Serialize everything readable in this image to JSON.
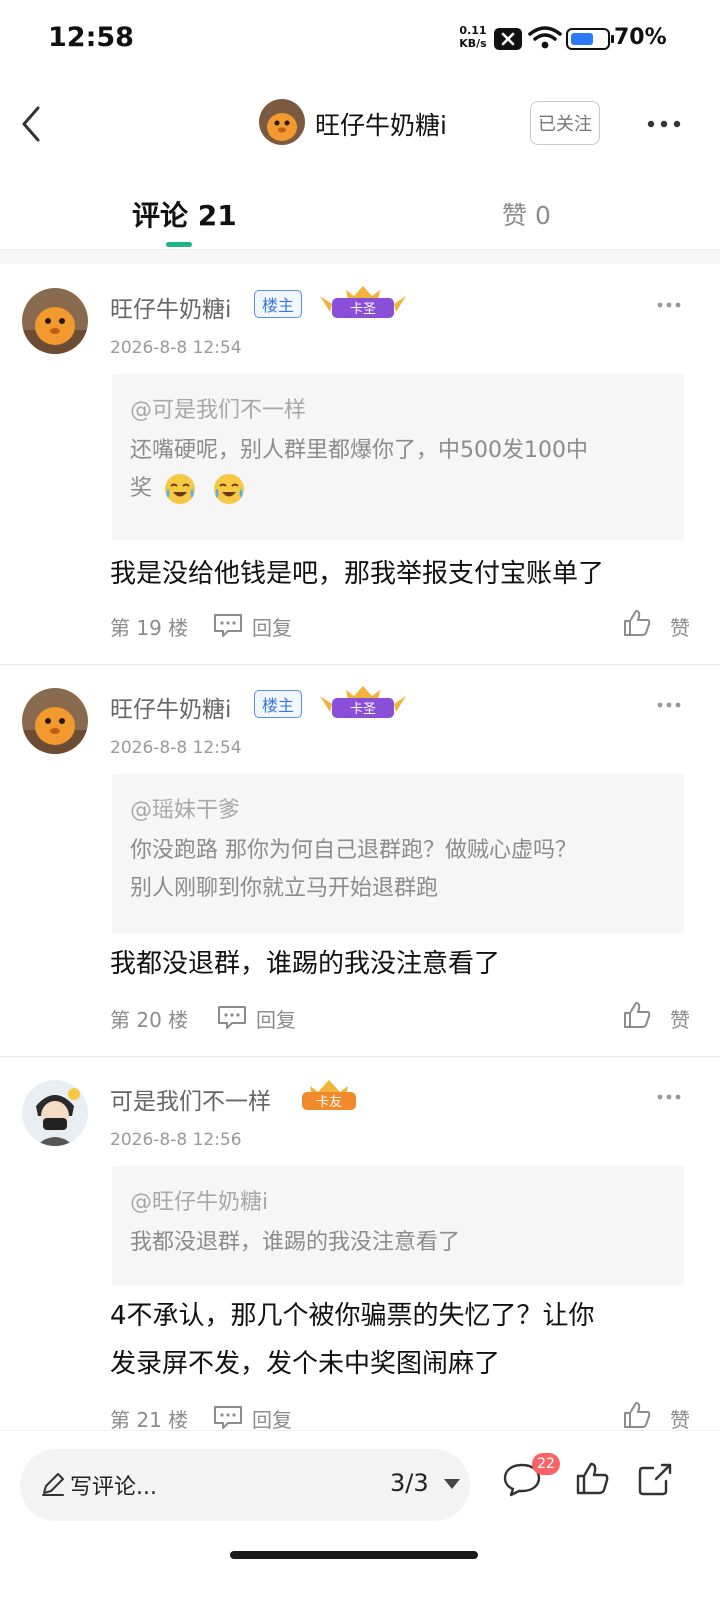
{
  "status_bar": {
    "time": "12:58",
    "net_speed": "0.11",
    "net_unit": "KB/s",
    "battery": "70%",
    "battery_level": 0.7
  },
  "header": {
    "username": "旺仔牛奶糖i",
    "follow_label": "已关注"
  },
  "tabs": {
    "comments_label": "评论 21",
    "likes_label": "赞 0"
  },
  "comments": [
    {
      "author": "旺仔牛奶糖i",
      "host_badge": "楼主",
      "level_badge": "卡圣",
      "time": "2026-8-8 12:54",
      "quote_target": "@可是我们不一样",
      "quote_text_1": "还嘴硬呢，别人群里都爆你了，中500发100中",
      "quote_text_2": "奖",
      "body": "我是没给他钱是吧，那我举报支付宝账单了",
      "floor": "第 19 楼",
      "reply_label": "回复",
      "like_label": "赞"
    },
    {
      "author": "旺仔牛奶糖i",
      "host_badge": "楼主",
      "level_badge": "卡圣",
      "time": "2026-8-8 12:54",
      "quote_target": "@瑶妹干爹",
      "quote_text_1": "你没跑路 那你为何自己退群跑？做贼心虚吗？",
      "quote_text_2": "别人刚聊到你就立马开始退群跑",
      "body": "我都没退群，谁踢的我没注意看了",
      "floor": "第 20 楼",
      "reply_label": "回复",
      "like_label": "赞"
    },
    {
      "author": "可是我们不一样",
      "level_badge": "卡友",
      "time": "2026-8-8 12:56",
      "quote_target": "@旺仔牛奶糖i",
      "quote_text_1": "我都没退群，谁踢的我没注意看了",
      "body_1": "4不承认，那几个被你骗票的失忆了？让你",
      "body_2": "发录屏不发，发个未中奖图闹麻了",
      "floor": "第 21 楼",
      "reply_label": "回复",
      "like_label": "赞"
    }
  ],
  "bottom_bar": {
    "comment_placeholder": "写评论...",
    "page_indicator": "3/3",
    "comment_count": "22"
  },
  "colors": {
    "accent": "#1fb38a",
    "host_badge": "#3b77e0",
    "badge_red": "#f56565"
  }
}
